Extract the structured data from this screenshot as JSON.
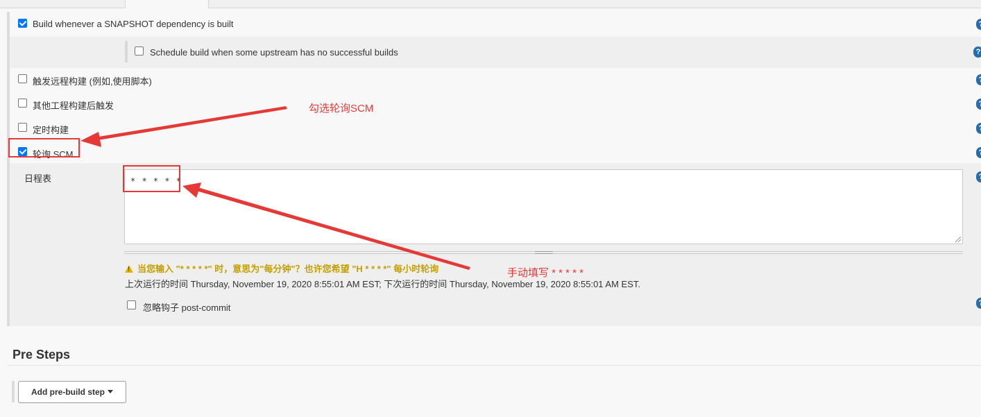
{
  "triggers": {
    "snapshot": {
      "label": "Build whenever a SNAPSHOT dependency is built",
      "checked": true
    },
    "upstream": {
      "label": "Schedule build when some upstream has no successful builds",
      "checked": false
    },
    "remote": {
      "label": "触发远程构建 (例如,使用脚本)",
      "checked": false
    },
    "after_other": {
      "label": "其他工程构建后触发",
      "checked": false
    },
    "periodic": {
      "label": "定时构建",
      "checked": false
    },
    "poll_scm": {
      "label": "轮询 SCM",
      "checked": true
    }
  },
  "schedule": {
    "label": "日程表",
    "value": "* * * * *",
    "warning": "当您输入 \"* * * * *\" 时，意思为\"每分钟\"？也许您希望 \"H * * * *\" 每小时轮询",
    "run_info": "上次运行的时间 Thursday, November 19, 2020 8:55:01 AM EST; 下次运行的时间 Thursday, November 19, 2020 8:55:01 AM EST.",
    "ignore_hooks": {
      "label": "忽略钩子 post-commit",
      "checked": false
    }
  },
  "pre_steps": {
    "title": "Pre Steps",
    "add_button": "Add pre-build step"
  },
  "annotations": {
    "check_poll": "勾选轮询SCM",
    "fill_manual": "手动填写 * * * * *"
  },
  "help_icon": "question-mark-icon",
  "colors": {
    "accent": "#0075ff",
    "annotation": "#e53935",
    "warning": "#c4a000"
  }
}
